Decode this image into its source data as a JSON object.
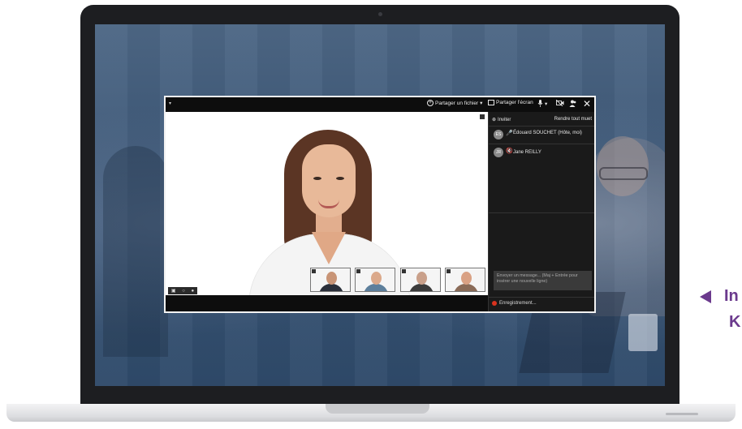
{
  "toolbar": {
    "share_file": "Partager un fichier",
    "share_screen": "Partager l'écran"
  },
  "panel": {
    "invite": "Inviter",
    "mute_all": "Rendre tout muet",
    "participants": [
      {
        "initials": "ES",
        "name": "Édouard SOUCHET (Hôte, moi)"
      },
      {
        "initials": "JR",
        "name": "Jane REILLY"
      }
    ],
    "message_placeholder": "Envoyer un message... (Maj + Entrée pour insérer une nouvelle ligne)",
    "recording": "Enregistrement..."
  },
  "callout": {
    "line1": "In",
    "line2": "K"
  },
  "colors": {
    "accent_purple": "#6b3a8d",
    "record_red": "#d9321e"
  }
}
